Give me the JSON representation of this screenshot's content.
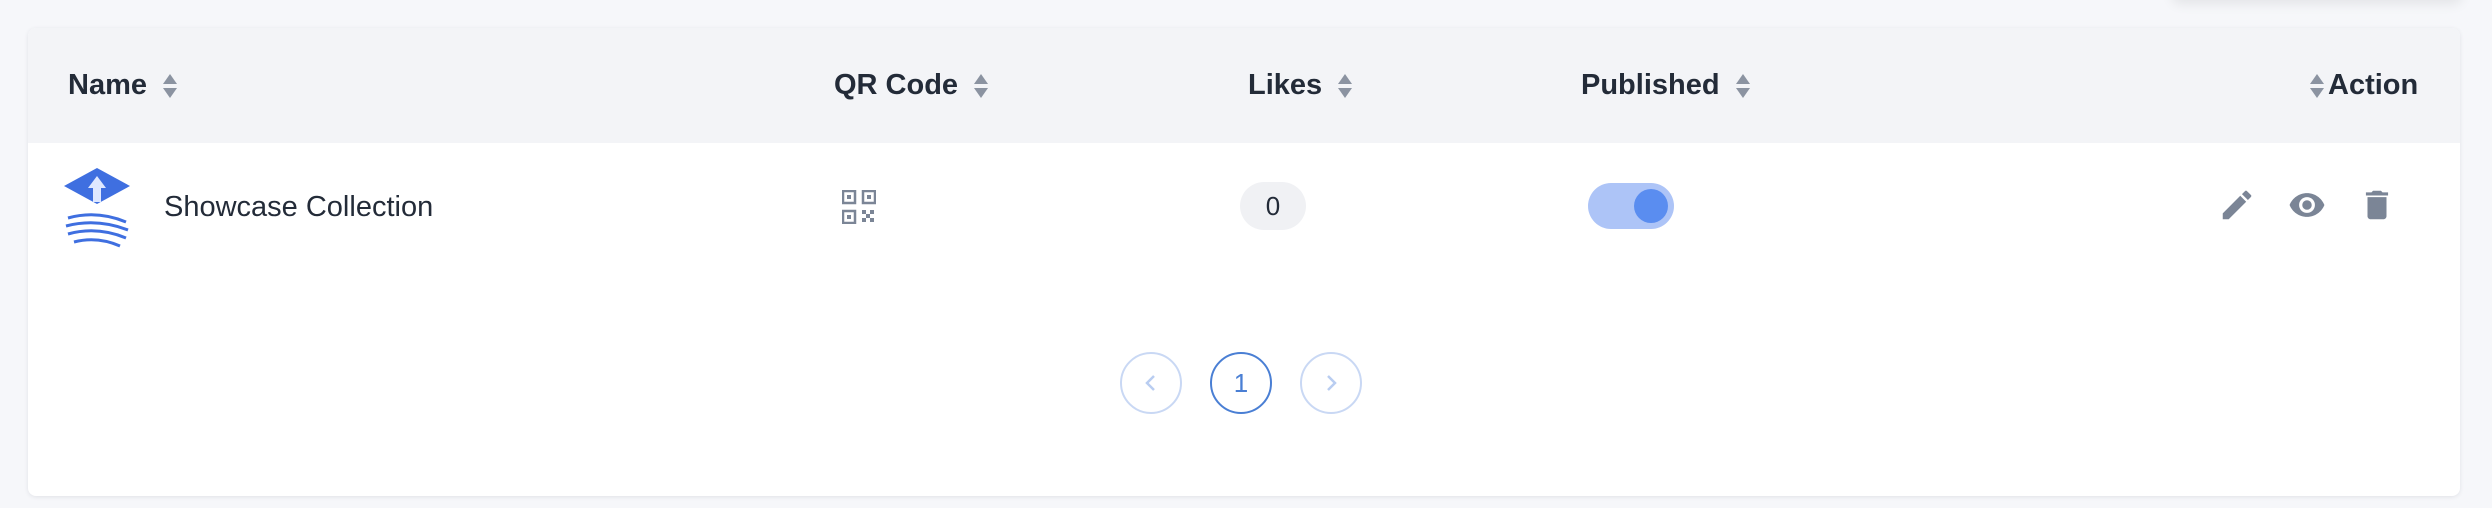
{
  "table": {
    "columns": [
      {
        "label": "Name"
      },
      {
        "label": "QR Code"
      },
      {
        "label": "Likes"
      },
      {
        "label": "Published"
      },
      {
        "label": "Action"
      }
    ],
    "rows": [
      {
        "name": "Showcase Collection",
        "qr_icon": "qr-code-icon",
        "likes": "0",
        "published": true,
        "actions": [
          "edit-icon",
          "view-icon",
          "delete-icon"
        ]
      }
    ]
  },
  "pagination": {
    "current_page": "1",
    "prev_icon": "chevron-left-icon",
    "next_icon": "chevron-right-icon"
  },
  "colors": {
    "accent": "#5a8df0",
    "toggle_track": "#adc4f7",
    "logo_blue": "#3f6fe0",
    "header_bg": "#f3f4f7"
  }
}
